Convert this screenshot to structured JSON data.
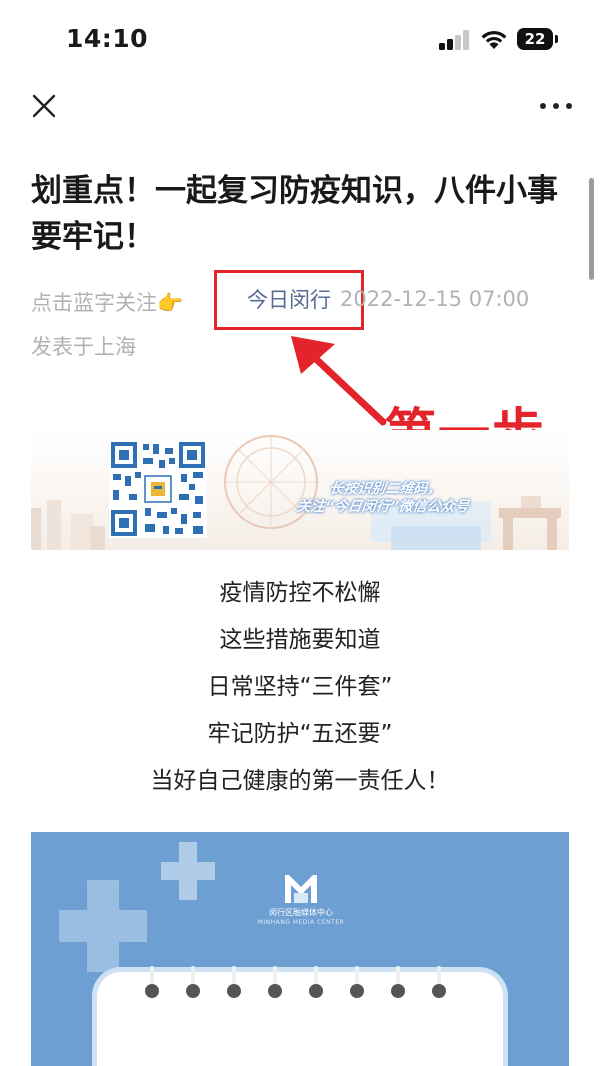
{
  "status_bar": {
    "time": "14:10",
    "battery": "22",
    "icons": [
      "cellular-signal-icon",
      "wifi-icon",
      "battery-icon"
    ]
  },
  "nav": {
    "close_icon": "close-icon",
    "more_icon": "more-icon"
  },
  "article": {
    "title": "划重点！一起复习防疫知识，八件小事要牢记！",
    "follow_hint": "点击蓝字关注👉",
    "account_name": "今日闵行",
    "publish_date": "2022-12-15 07:00",
    "location": "发表于上海",
    "link_color": "#576b95"
  },
  "annotation": {
    "step_label": "第一步",
    "color": "#e3242b"
  },
  "banner": {
    "caption_line1": "长按识别二维码，",
    "caption_line2": "关注“今日闵行”微信公众号"
  },
  "body_lines": [
    "疫情防控不松懈",
    "这些措施要知道",
    "日常坚持“三件套”",
    "牢记防护“五还要”",
    "当好自己健康的第一责任人！"
  ],
  "poster": {
    "org_name": "闵行区融媒体中心",
    "org_name_en": "MINHANG MEDIA CENTER",
    "background": "#6e9fd3"
  }
}
